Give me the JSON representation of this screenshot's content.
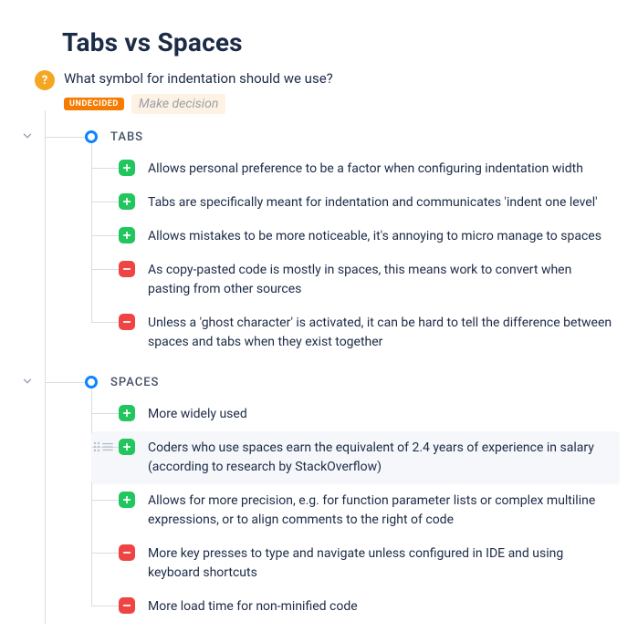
{
  "title": "Tabs vs Spaces",
  "root": {
    "question": "What symbol for indentation should we use?",
    "status_badge": "UNDECIDED",
    "action_label": "Make decision"
  },
  "sections": [
    {
      "label": "TABS",
      "items": [
        {
          "kind": "plus",
          "text": "Allows personal preference to be a factor when configuring indentation width"
        },
        {
          "kind": "plus",
          "text": "Tabs are specifically meant for indentation and communicates 'indent one level'"
        },
        {
          "kind": "plus",
          "text": "Allows mistakes to be more noticeable, it's annoying to micro manage to spaces"
        },
        {
          "kind": "minus",
          "text": "As copy-pasted code is mostly in spaces, this means work to convert when pasting from other sources"
        },
        {
          "kind": "minus",
          "text": "Unless a 'ghost character' is activated, it can be hard to tell the difference between spaces and tabs when they exist together"
        }
      ]
    },
    {
      "label": "SPACES",
      "items": [
        {
          "kind": "plus",
          "text": "More widely used"
        },
        {
          "kind": "plus",
          "text": "Coders who use spaces earn the equivalent of 2.4 years of experience in salary (according to research by StackOverflow)",
          "hovered": true
        },
        {
          "kind": "plus",
          "text": "Allows for more precision, e.g. for function parameter lists or complex multiline expressions, or to align comments to the right of code"
        },
        {
          "kind": "minus",
          "text": "More key presses to type and navigate unless configured in IDE and using keyboard shortcuts"
        },
        {
          "kind": "minus",
          "text": "More load time for non-minified code"
        }
      ]
    }
  ]
}
